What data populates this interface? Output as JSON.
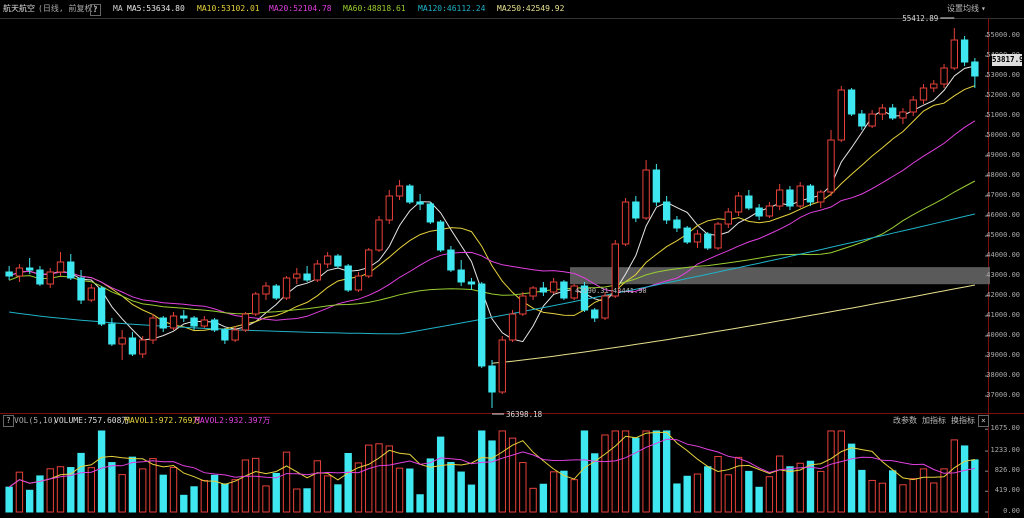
{
  "header": {
    "stock_name": "航天航空",
    "mode": "(日线, 前复权)",
    "help": "?",
    "ma_label": "MA",
    "ma5": "MA5:53634.80",
    "ma10": "MA10:53102.01",
    "ma20": "MA20:52104.78",
    "ma60": "MA60:48818.61",
    "ma120": "MA120:46112.24",
    "ma250": "MA250:42549.92",
    "settings": "设置均线",
    "settings_caret": "▾"
  },
  "volume_header": {
    "help": "?",
    "label": "VOL(5,10)",
    "volume": "VOLUME:757.608万",
    "mavol1": "MAVOL1:972.769万",
    "mavol2": "MAVOL2:932.397万",
    "btn_change_param": "改参数",
    "btn_add_indicator": "加指标",
    "btn_switch_indicator": "换指标",
    "close": "×"
  },
  "price_axis": [
    "55000.00",
    "54000.00",
    "53000.00",
    "52000.00",
    "51000.00",
    "50000.00",
    "49000.00",
    "48000.00",
    "47000.00",
    "46000.00",
    "45000.00",
    "44000.00",
    "43000.00",
    "42000.00",
    "41000.00",
    "40000.00",
    "39000.00",
    "38000.00",
    "37000.00"
  ],
  "volume_axis": [
    "1675.00",
    "1233.00",
    "826.00",
    "419.00",
    "0.00"
  ],
  "current_price": "53817.9",
  "annotations": {
    "high": "55412.89",
    "low": "36398.18",
    "range": "42590.31~43441.90"
  },
  "colors": {
    "up": "#e8413a",
    "down": "#3fe8f0",
    "ma5": "#e6e6e6",
    "ma10": "#e6d23c",
    "ma20": "#e040e0",
    "ma60": "#9acd32",
    "ma120": "#20b2c8",
    "ma250": "#e6e08c",
    "mavol1": "#e6d23c",
    "mavol2": "#e040e0"
  },
  "chart_data": {
    "type": "candlestick",
    "price_range": [
      36300,
      55900
    ],
    "volume_range": [
      0,
      1700
    ],
    "close_keypoints": [
      [
        0,
        43100
      ],
      [
        5,
        43400
      ],
      [
        9,
        42200
      ],
      [
        12,
        40400
      ],
      [
        14,
        39100
      ],
      [
        18,
        39900
      ],
      [
        22,
        41000
      ],
      [
        26,
        40800
      ],
      [
        30,
        40100
      ],
      [
        34,
        40000
      ],
      [
        38,
        41800
      ],
      [
        42,
        42600
      ],
      [
        46,
        43000
      ],
      [
        50,
        42900
      ],
      [
        54,
        43300
      ],
      [
        58,
        43400
      ],
      [
        61,
        42400
      ],
      [
        64,
        44800
      ],
      [
        68,
        46200
      ],
      [
        70,
        47200
      ],
      [
        73,
        46600
      ],
      [
        76,
        46400
      ],
      [
        79,
        45600
      ],
      [
        82,
        44500
      ],
      [
        85,
        43500
      ],
      [
        88,
        42800
      ],
      [
        90,
        38500
      ],
      [
        92,
        37200
      ],
      [
        94,
        40800
      ],
      [
        96,
        42100
      ],
      [
        100,
        42500
      ],
      [
        104,
        42600
      ],
      [
        108,
        42000
      ],
      [
        110,
        41500
      ],
      [
        112,
        40900
      ],
      [
        114,
        42000
      ],
      [
        116,
        43700
      ],
      [
        118,
        46200
      ],
      [
        120,
        47800
      ],
      [
        122,
        46700
      ],
      [
        126,
        45600
      ],
      [
        130,
        45000
      ],
      [
        134,
        44700
      ],
      [
        136,
        45200
      ],
      [
        140,
        46200
      ],
      [
        144,
        46300
      ],
      [
        148,
        46000
      ],
      [
        152,
        46800
      ],
      [
        156,
        46700
      ],
      [
        158,
        47200
      ],
      [
        160,
        48800
      ],
      [
        162,
        51800
      ],
      [
        164,
        51600
      ],
      [
        166,
        50900
      ],
      [
        170,
        51200
      ],
      [
        174,
        51100
      ],
      [
        178,
        51000
      ],
      [
        182,
        51500
      ],
      [
        184,
        52300
      ],
      [
        188,
        53000
      ],
      [
        190,
        52500
      ],
      [
        192,
        54400
      ],
      [
        194,
        55300
      ],
      [
        196,
        53800
      ],
      [
        197,
        53817
      ]
    ],
    "candles": [
      {
        "o": 43200,
        "h": 43500,
        "l": 42800,
        "c": 43000
      },
      {
        "o": 43000,
        "h": 43600,
        "l": 42700,
        "c": 43400
      },
      {
        "o": 43400,
        "h": 43900,
        "l": 43100,
        "c": 43300
      },
      {
        "o": 43300,
        "h": 43500,
        "l": 42500,
        "c": 42600
      },
      {
        "o": 42600,
        "h": 43400,
        "l": 42400,
        "c": 43200
      },
      {
        "o": 43200,
        "h": 44200,
        "l": 43000,
        "c": 43700
      },
      {
        "o": 43700,
        "h": 44100,
        "l": 42800,
        "c": 42900
      },
      {
        "o": 42900,
        "h": 43300,
        "l": 41600,
        "c": 41800
      },
      {
        "o": 41800,
        "h": 42600,
        "l": 41700,
        "c": 42400
      },
      {
        "o": 42400,
        "h": 42500,
        "l": 40500,
        "c": 40600
      },
      {
        "o": 40600,
        "h": 40900,
        "l": 39500,
        "c": 39600
      },
      {
        "o": 39600,
        "h": 40300,
        "l": 38800,
        "c": 39900
      },
      {
        "o": 39900,
        "h": 40200,
        "l": 39000,
        "c": 39100
      },
      {
        "o": 39100,
        "h": 40000,
        "l": 38900,
        "c": 39800
      },
      {
        "o": 39800,
        "h": 41100,
        "l": 39600,
        "c": 40900
      },
      {
        "o": 40900,
        "h": 41000,
        "l": 40200,
        "c": 40400
      },
      {
        "o": 40400,
        "h": 41200,
        "l": 40300,
        "c": 41000
      },
      {
        "o": 41000,
        "h": 41300,
        "l": 40700,
        "c": 40900
      },
      {
        "o": 40900,
        "h": 41000,
        "l": 40300,
        "c": 40500
      },
      {
        "o": 40500,
        "h": 41000,
        "l": 40400,
        "c": 40800
      },
      {
        "o": 40800,
        "h": 40900,
        "l": 40200,
        "c": 40300
      },
      {
        "o": 40300,
        "h": 40400,
        "l": 39600,
        "c": 39800
      },
      {
        "o": 39800,
        "h": 40500,
        "l": 39700,
        "c": 40300
      },
      {
        "o": 40300,
        "h": 41200,
        "l": 40200,
        "c": 41100
      },
      {
        "o": 41100,
        "h": 42200,
        "l": 41000,
        "c": 42100
      },
      {
        "o": 42100,
        "h": 42700,
        "l": 41800,
        "c": 42500
      },
      {
        "o": 42500,
        "h": 42600,
        "l": 41800,
        "c": 41900
      },
      {
        "o": 41900,
        "h": 43000,
        "l": 41800,
        "c": 42900
      },
      {
        "o": 42900,
        "h": 43400,
        "l": 42600,
        "c": 43100
      },
      {
        "o": 43100,
        "h": 43500,
        "l": 42700,
        "c": 42800
      },
      {
        "o": 42800,
        "h": 43800,
        "l": 42700,
        "c": 43600
      },
      {
        "o": 43600,
        "h": 44200,
        "l": 43400,
        "c": 44000
      },
      {
        "o": 44000,
        "h": 44100,
        "l": 43400,
        "c": 43500
      },
      {
        "o": 43500,
        "h": 43600,
        "l": 42200,
        "c": 42300
      },
      {
        "o": 42300,
        "h": 43200,
        "l": 42200,
        "c": 43000
      },
      {
        "o": 43000,
        "h": 44400,
        "l": 42900,
        "c": 44300
      },
      {
        "o": 44300,
        "h": 46000,
        "l": 44200,
        "c": 45800
      },
      {
        "o": 45800,
        "h": 47300,
        "l": 45600,
        "c": 47000
      },
      {
        "o": 47000,
        "h": 47800,
        "l": 46800,
        "c": 47500
      },
      {
        "o": 47500,
        "h": 47600,
        "l": 46600,
        "c": 46700
      },
      {
        "o": 46700,
        "h": 47100,
        "l": 46300,
        "c": 46600
      },
      {
        "o": 46600,
        "h": 46700,
        "l": 45600,
        "c": 45700
      },
      {
        "o": 45700,
        "h": 45800,
        "l": 44200,
        "c": 44300
      },
      {
        "o": 44300,
        "h": 44500,
        "l": 43200,
        "c": 43300
      },
      {
        "o": 43300,
        "h": 43800,
        "l": 42500,
        "c": 42700
      },
      {
        "o": 42700,
        "h": 42900,
        "l": 42300,
        "c": 42600
      },
      {
        "o": 42600,
        "h": 42700,
        "l": 38400,
        "c": 38500
      },
      {
        "o": 38500,
        "h": 38800,
        "l": 36400,
        "c": 37200
      },
      {
        "o": 37200,
        "h": 40000,
        "l": 37100,
        "c": 39800
      },
      {
        "o": 39800,
        "h": 41300,
        "l": 39700,
        "c": 41100
      },
      {
        "o": 41100,
        "h": 42200,
        "l": 41000,
        "c": 42000
      },
      {
        "o": 42000,
        "h": 42500,
        "l": 41800,
        "c": 42400
      },
      {
        "o": 42400,
        "h": 42700,
        "l": 42000,
        "c": 42200
      },
      {
        "o": 42200,
        "h": 42900,
        "l": 42100,
        "c": 42700
      },
      {
        "o": 42700,
        "h": 42800,
        "l": 41800,
        "c": 41900
      },
      {
        "o": 41900,
        "h": 42600,
        "l": 41800,
        "c": 42500
      },
      {
        "o": 42500,
        "h": 42700,
        "l": 41200,
        "c": 41300
      },
      {
        "o": 41300,
        "h": 41400,
        "l": 40700,
        "c": 40900
      },
      {
        "o": 40900,
        "h": 42200,
        "l": 40800,
        "c": 42000
      },
      {
        "o": 42000,
        "h": 44800,
        "l": 41900,
        "c": 44600
      },
      {
        "o": 44600,
        "h": 46900,
        "l": 44500,
        "c": 46700
      },
      {
        "o": 46700,
        "h": 47000,
        "l": 45700,
        "c": 45900
      },
      {
        "o": 45900,
        "h": 48800,
        "l": 45800,
        "c": 48300
      },
      {
        "o": 48300,
        "h": 48600,
        "l": 46500,
        "c": 46700
      },
      {
        "o": 46700,
        "h": 47000,
        "l": 45600,
        "c": 45800
      },
      {
        "o": 45800,
        "h": 46000,
        "l": 45200,
        "c": 45400
      },
      {
        "o": 45400,
        "h": 45500,
        "l": 44600,
        "c": 44700
      },
      {
        "o": 44700,
        "h": 45300,
        "l": 44400,
        "c": 45100
      },
      {
        "o": 45100,
        "h": 45200,
        "l": 44300,
        "c": 44400
      },
      {
        "o": 44400,
        "h": 45700,
        "l": 44300,
        "c": 45600
      },
      {
        "o": 45600,
        "h": 46400,
        "l": 45400,
        "c": 46200
      },
      {
        "o": 46200,
        "h": 47200,
        "l": 46000,
        "c": 47000
      },
      {
        "o": 47000,
        "h": 47300,
        "l": 46300,
        "c": 46400
      },
      {
        "o": 46400,
        "h": 46600,
        "l": 45800,
        "c": 46000
      },
      {
        "o": 46000,
        "h": 46700,
        "l": 45900,
        "c": 46500
      },
      {
        "o": 46500,
        "h": 47600,
        "l": 46300,
        "c": 47300
      },
      {
        "o": 47300,
        "h": 47500,
        "l": 46300,
        "c": 46500
      },
      {
        "o": 46500,
        "h": 47700,
        "l": 46400,
        "c": 47500
      },
      {
        "o": 47500,
        "h": 47600,
        "l": 46500,
        "c": 46700
      },
      {
        "o": 46700,
        "h": 47300,
        "l": 46400,
        "c": 47200
      },
      {
        "o": 47200,
        "h": 50300,
        "l": 47000,
        "c": 49800
      },
      {
        "o": 49800,
        "h": 52500,
        "l": 49700,
        "c": 52300
      },
      {
        "o": 52300,
        "h": 52400,
        "l": 51000,
        "c": 51100
      },
      {
        "o": 51100,
        "h": 51300,
        "l": 50300,
        "c": 50500
      },
      {
        "o": 50500,
        "h": 51300,
        "l": 50400,
        "c": 51100
      },
      {
        "o": 51100,
        "h": 51600,
        "l": 50800,
        "c": 51400
      },
      {
        "o": 51400,
        "h": 51600,
        "l": 50800,
        "c": 50900
      },
      {
        "o": 50900,
        "h": 51400,
        "l": 50600,
        "c": 51200
      },
      {
        "o": 51200,
        "h": 52000,
        "l": 51000,
        "c": 51800
      },
      {
        "o": 51800,
        "h": 52600,
        "l": 51600,
        "c": 52400
      },
      {
        "o": 52400,
        "h": 52800,
        "l": 52200,
        "c": 52600
      },
      {
        "o": 52600,
        "h": 53600,
        "l": 52400,
        "c": 53400
      },
      {
        "o": 53400,
        "h": 55400,
        "l": 53300,
        "c": 54800
      },
      {
        "o": 54800,
        "h": 55000,
        "l": 53500,
        "c": 53700
      },
      {
        "o": 53700,
        "h": 53900,
        "l": 52400,
        "c": 53000
      }
    ]
  }
}
